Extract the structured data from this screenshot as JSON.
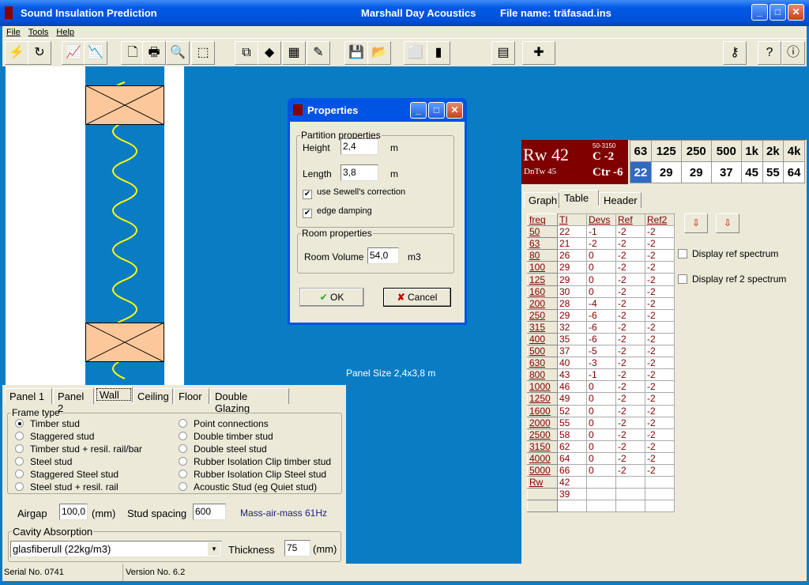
{
  "window": {
    "title": "Sound Insulation Prediction",
    "company": "Marshall Day Acoustics",
    "file": "File name: träfasad.ins"
  },
  "menu": [
    "File",
    "Tools",
    "Help"
  ],
  "toolbar_icons": [
    "calculate-icon",
    "refresh-icon",
    "graph-icon",
    "graph-compare-icon",
    "new-icon",
    "print-icon",
    "preview-icon",
    "pdf-icon",
    "copy-icon",
    "material-icon",
    "chart-icon",
    "edit-icon",
    "save-icon",
    "open-icon",
    "box-icon",
    "door-icon",
    "calculator-icon",
    "add-calculator-icon",
    "key-icon",
    "help-icon",
    "info-icon"
  ],
  "panel_size": "Panel Size 2,4x3,8 m",
  "dialog": {
    "title": "Properties",
    "partition_legend": "Partition properties",
    "height_label": "Height",
    "height": "2,4",
    "length_label": "Length",
    "length": "3,8",
    "unit_m": "m",
    "sewell": "use Sewell's correction",
    "sewell_checked": true,
    "edge": "edge damping",
    "edge_checked": true,
    "room_legend": "Room properties",
    "volume_label": "Room Volume",
    "volume": "54,0",
    "unit_m3": "m3",
    "ok": "OK",
    "cancel": "Cancel"
  },
  "rating": {
    "rw": "Rw 42",
    "dntw": "DnTw 45",
    "range": "50-3150",
    "c": "C -2",
    "ctr": "Ctr -6"
  },
  "octave": {
    "bands": [
      "63",
      "125",
      "250",
      "500",
      "1k",
      "2k",
      "4k"
    ],
    "values": [
      "22",
      "29",
      "29",
      "37",
      "45",
      "55",
      "64"
    ]
  },
  "right_tabs": [
    "Graph",
    "Table",
    "Header"
  ],
  "right_options": {
    "ref": "Display ref spectrum",
    "ref2": "Display ref 2 spectrum"
  },
  "table": {
    "headers": [
      "freq",
      "TI",
      "Devs",
      "Ref",
      "Ref2"
    ],
    "rows": [
      [
        "50",
        "22",
        "-1",
        "-2",
        "-2"
      ],
      [
        "63",
        "21",
        "-2",
        "-2",
        "-2"
      ],
      [
        "80",
        "26",
        "0",
        "-2",
        "-2"
      ],
      [
        "100",
        "29",
        "0",
        "-2",
        "-2"
      ],
      [
        "125",
        "29",
        "0",
        "-2",
        "-2"
      ],
      [
        "160",
        "30",
        "0",
        "-2",
        "-2"
      ],
      [
        "200",
        "28",
        "-4",
        "-2",
        "-2"
      ],
      [
        "250",
        "29",
        "-6",
        "-2",
        "-2"
      ],
      [
        "315",
        "32",
        "-6",
        "-2",
        "-2"
      ],
      [
        "400",
        "35",
        "-6",
        "-2",
        "-2"
      ],
      [
        "500",
        "37",
        "-5",
        "-2",
        "-2"
      ],
      [
        "630",
        "40",
        "-3",
        "-2",
        "-2"
      ],
      [
        "800",
        "43",
        "-1",
        "-2",
        "-2"
      ],
      [
        "1000",
        "46",
        "0",
        "-2",
        "-2"
      ],
      [
        "1250",
        "49",
        "0",
        "-2",
        "-2"
      ],
      [
        "1600",
        "52",
        "0",
        "-2",
        "-2"
      ],
      [
        "2000",
        "55",
        "0",
        "-2",
        "-2"
      ],
      [
        "2500",
        "58",
        "0",
        "-2",
        "-2"
      ],
      [
        "3150",
        "62",
        "0",
        "-2",
        "-2"
      ],
      [
        "4000",
        "64",
        "0",
        "-2",
        "-2"
      ],
      [
        "5000",
        "66",
        "0",
        "-2",
        "-2"
      ],
      [
        "Rw",
        "42",
        "",
        "",
        ""
      ],
      [
        "",
        "39",
        "",
        "",
        ""
      ],
      [
        "",
        "",
        "",
        "",
        ""
      ]
    ]
  },
  "bottom_tabs": [
    "Panel 1",
    "Panel 2",
    "Wall",
    "Ceiling",
    "Floor",
    "Double Glazing"
  ],
  "frame": {
    "legend": "Frame type",
    "selected": "Timber stud",
    "left": [
      "Timber stud",
      "Staggered stud",
      "Timber stud + resil. rail/bar",
      "Steel stud",
      "Staggered Steel stud",
      "Steel stud + resil. rail"
    ],
    "right": [
      "Point connections",
      "Double timber stud",
      "Double steel stud",
      "Rubber Isolation Clip timber stud",
      "Rubber Isolation Clip Steel stud",
      "Acoustic Stud (eg Quiet stud)"
    ]
  },
  "airgap_label": "Airgap",
  "airgap": "100,0",
  "mm": "(mm)",
  "stud_label": "Stud spacing",
  "stud": "600",
  "mam": "Mass-air-mass 61Hz",
  "cavity": {
    "legend": "Cavity Absorption",
    "value": "glasfiberull (22kg/m3)",
    "thickness_label": "Thickness",
    "thickness": "75",
    "unit": "(mm)"
  },
  "status": {
    "serial": "Serial No. 0741",
    "version": "Version No. 6.2"
  }
}
